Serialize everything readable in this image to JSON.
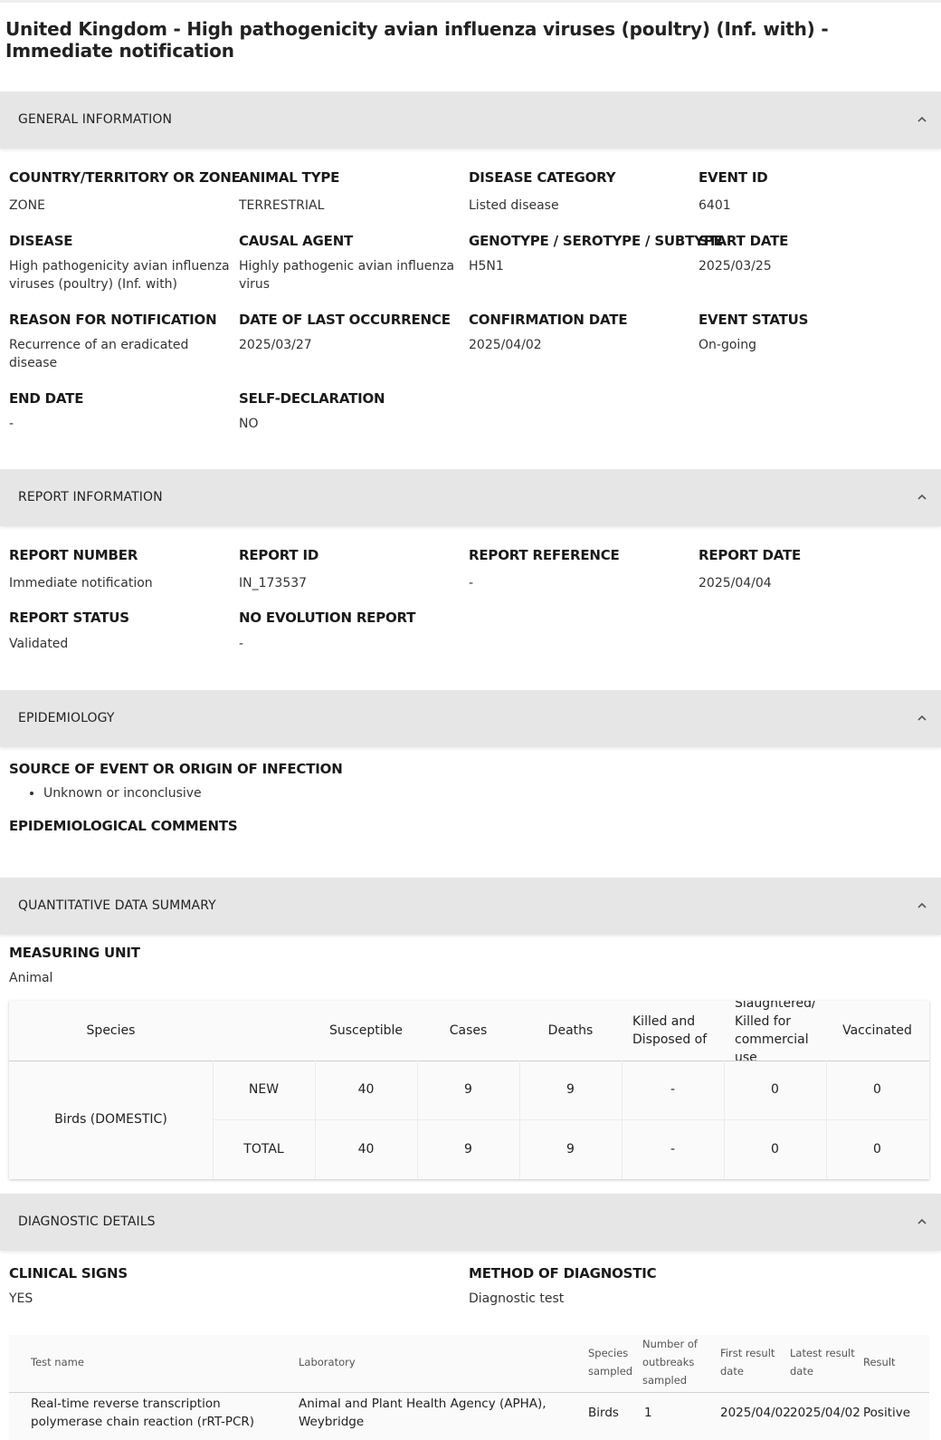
{
  "title": "United Kingdom - High pathogenicity avian influenza viruses (poultry) (Inf. with) - Immediate notification",
  "sections": {
    "general": "GENERAL INFORMATION",
    "report": "REPORT INFORMATION",
    "epidemiology": "EPIDEMIOLOGY",
    "quantitative": "QUANTITATIVE DATA SUMMARY",
    "diagnostic": "DIAGNOSTIC DETAILS"
  },
  "general_fields": [
    {
      "label": "COUNTRY/TERRITORY OR ZONE",
      "value": "ZONE"
    },
    {
      "label": "ANIMAL TYPE",
      "value": "TERRESTRIAL"
    },
    {
      "label": "DISEASE CATEGORY",
      "value": "Listed disease"
    },
    {
      "label": "EVENT ID",
      "value": "6401"
    },
    {
      "label": "DISEASE",
      "value": "High pathogenicity avian influenza viruses (poultry) (Inf. with)"
    },
    {
      "label": "CAUSAL AGENT",
      "value": "Highly pathogenic avian influenza virus"
    },
    {
      "label": "GENOTYPE / SEROTYPE / SUBTYPE",
      "value": "H5N1"
    },
    {
      "label": "START DATE",
      "value": "2025/03/25"
    },
    {
      "label": "REASON FOR NOTIFICATION",
      "value": "Recurrence of an eradicated disease"
    },
    {
      "label": "DATE OF LAST OCCURRENCE",
      "value": "2025/03/27"
    },
    {
      "label": "CONFIRMATION DATE",
      "value": "2025/04/02"
    },
    {
      "label": "EVENT STATUS",
      "value": "On-going"
    },
    {
      "label": "END DATE",
      "value": "-"
    },
    {
      "label": "SELF-DECLARATION",
      "value": "NO"
    }
  ],
  "report_fields": [
    {
      "label": "REPORT NUMBER",
      "value": "Immediate notification"
    },
    {
      "label": "REPORT ID",
      "value": "IN_173537"
    },
    {
      "label": "REPORT REFERENCE",
      "value": "-"
    },
    {
      "label": "REPORT DATE",
      "value": "2025/04/04"
    },
    {
      "label": "REPORT STATUS",
      "value": "Validated"
    },
    {
      "label": "NO EVOLUTION REPORT",
      "value": "-"
    }
  ],
  "epidemiology": {
    "source_label": "SOURCE OF EVENT OR ORIGIN OF INFECTION",
    "sources": [
      "Unknown or inconclusive"
    ],
    "comments_label": "EPIDEMIOLOGICAL COMMENTS"
  },
  "quantitative": {
    "unit_label": "MEASURING UNIT",
    "unit_value": "Animal",
    "headers": [
      "Species",
      "Susceptible",
      "Cases",
      "Deaths",
      "Killed and Disposed of",
      "Slaughtered/ Killed for commercial use",
      "Vaccinated"
    ],
    "species": "Birds (DOMESTIC)",
    "rows": [
      {
        "label": "NEW",
        "values": [
          "40",
          "9",
          "9",
          "-",
          "0",
          "0"
        ]
      },
      {
        "label": "TOTAL",
        "values": [
          "40",
          "9",
          "9",
          "-",
          "0",
          "0"
        ]
      }
    ]
  },
  "diagnostic": {
    "clinical_label": "CLINICAL SIGNS",
    "clinical_value": "YES",
    "method_label": "METHOD OF DIAGNOSTIC",
    "method_value": "Diagnostic test",
    "headers": [
      "Test name",
      "Laboratory",
      "Species sampled",
      "Number of outbreaks sampled",
      "First result date",
      "Latest result date",
      "Result"
    ],
    "rows": [
      {
        "test": "Real-time reverse transcription polymerase chain reaction (rRT-PCR)",
        "lab": "Animal and Plant Health Agency (APHA), Weybridge",
        "species": "Birds",
        "outbreaks": "1",
        "first": "2025/04/02",
        "latest": "2025/04/02",
        "result": "Positive"
      }
    ]
  }
}
